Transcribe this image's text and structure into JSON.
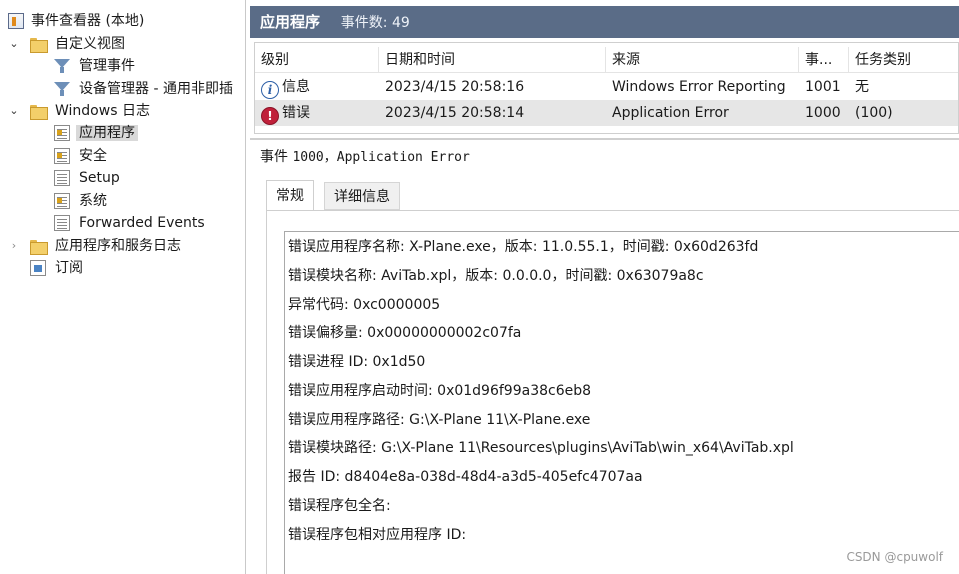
{
  "tree": {
    "root": "事件查看器 (本地)",
    "custom_views": "自定义视图",
    "admin_events": "管理事件",
    "device_manager": "设备管理器 - 通用非即插",
    "windows_logs": "Windows 日志",
    "application": "应用程序",
    "security": "安全",
    "setup": "Setup",
    "system": "系统",
    "forwarded": "Forwarded Events",
    "app_service_logs": "应用程序和服务日志",
    "subscriptions": "订阅"
  },
  "header": {
    "title": "应用程序",
    "count": "事件数: 49"
  },
  "columns": {
    "level": "级别",
    "datetime": "日期和时间",
    "source": "来源",
    "event_id": "事...",
    "task": "任务类别"
  },
  "events": [
    {
      "level": "信息",
      "level_icon": "info-icon",
      "datetime": "2023/4/15 20:58:16",
      "source": "Windows Error Reporting",
      "event_id": "1001",
      "task": "无"
    },
    {
      "level": "错误",
      "level_icon": "error-icon",
      "datetime": "2023/4/15 20:58:14",
      "source": "Application Error",
      "event_id": "1000",
      "task": "(100)"
    }
  ],
  "detail": {
    "title_prefix": "事件",
    "title_mono": "1000，Application Error",
    "tab_general": "常规",
    "tab_details": "详细信息",
    "lines": [
      "错误应用程序名称: X-Plane.exe，版本: 11.0.55.1，时间戳: 0x60d263fd",
      "错误模块名称: AviTab.xpl，版本: 0.0.0.0，时间戳: 0x63079a8c",
      "异常代码: 0xc0000005",
      "错误偏移量: 0x00000000002c07fa",
      "错误进程 ID: 0x1d50",
      "错误应用程序启动时间: 0x01d96f99a38c6eb8",
      "错误应用程序路径: G:\\X-Plane 11\\X-Plane.exe",
      "错误模块路径: G:\\X-Plane 11\\Resources\\plugins\\AviTab\\win_x64\\AviTab.xpl",
      "报告 ID: d8404e8a-038d-48d4-a3d5-405efc4707aa",
      "错误程序包全名:",
      "错误程序包相对应用程序 ID:"
    ]
  },
  "watermark": "CSDN @cpuwolf",
  "colors": {
    "header_bg": "#5a6c87",
    "error_red": "#c0203a",
    "info_blue": "#2d5fa6",
    "selection": "#d9d9d9"
  }
}
